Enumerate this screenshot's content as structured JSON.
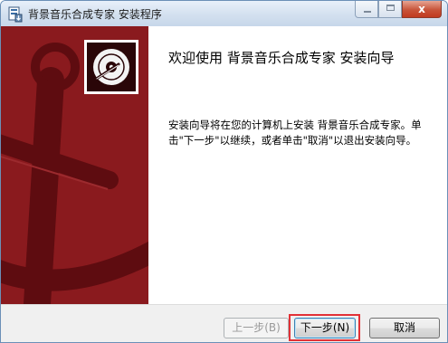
{
  "window": {
    "title": "背景音乐合成专家 安装程序",
    "close_glyph": "x"
  },
  "welcome": {
    "heading": "欢迎使用 背景音乐合成专家 安装向导",
    "description": "安装向导将在您的计算机上安装 背景音乐合成专家。单击\"下一步\"以继续，或者单击\"取消\"以退出安装向导。"
  },
  "buttons": {
    "back": "上一步(B)",
    "next": "下一步(N)",
    "cancel": "取消"
  },
  "colors": {
    "banner": "#8a1a1e",
    "highlight": "#e23137"
  },
  "icons": {
    "app": "installer-app-icon",
    "logo": "disc-icon"
  }
}
